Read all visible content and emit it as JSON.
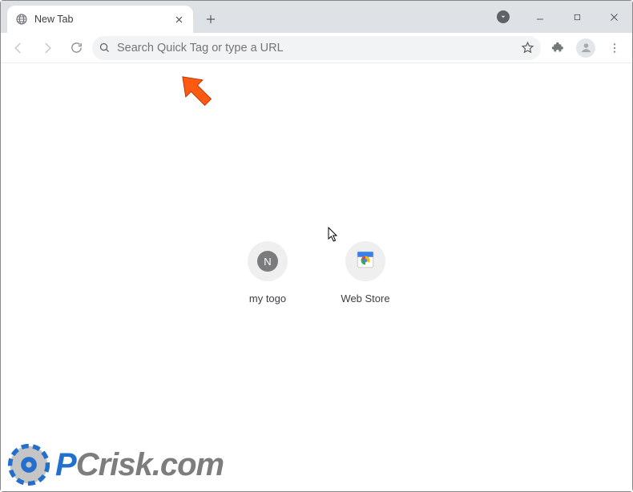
{
  "tab": {
    "title": "New Tab"
  },
  "omnibox": {
    "placeholder": "Search Quick Tag or type a URL",
    "value": ""
  },
  "shortcuts": {
    "items": [
      {
        "letter": "N",
        "label": "my togo"
      },
      {
        "letter": "",
        "label": "Web Store"
      }
    ]
  },
  "watermark": {
    "p": "P",
    "c": "C",
    "rest": "risk.com"
  },
  "colors": {
    "tabstrip_bg": "#dee1e6",
    "omnibox_bg": "#f1f3f4",
    "shortcut_bg": "#efeff0",
    "arrow": "#ff5a12",
    "wm_blue": "#0b60c9",
    "wm_gray": "#707070"
  }
}
